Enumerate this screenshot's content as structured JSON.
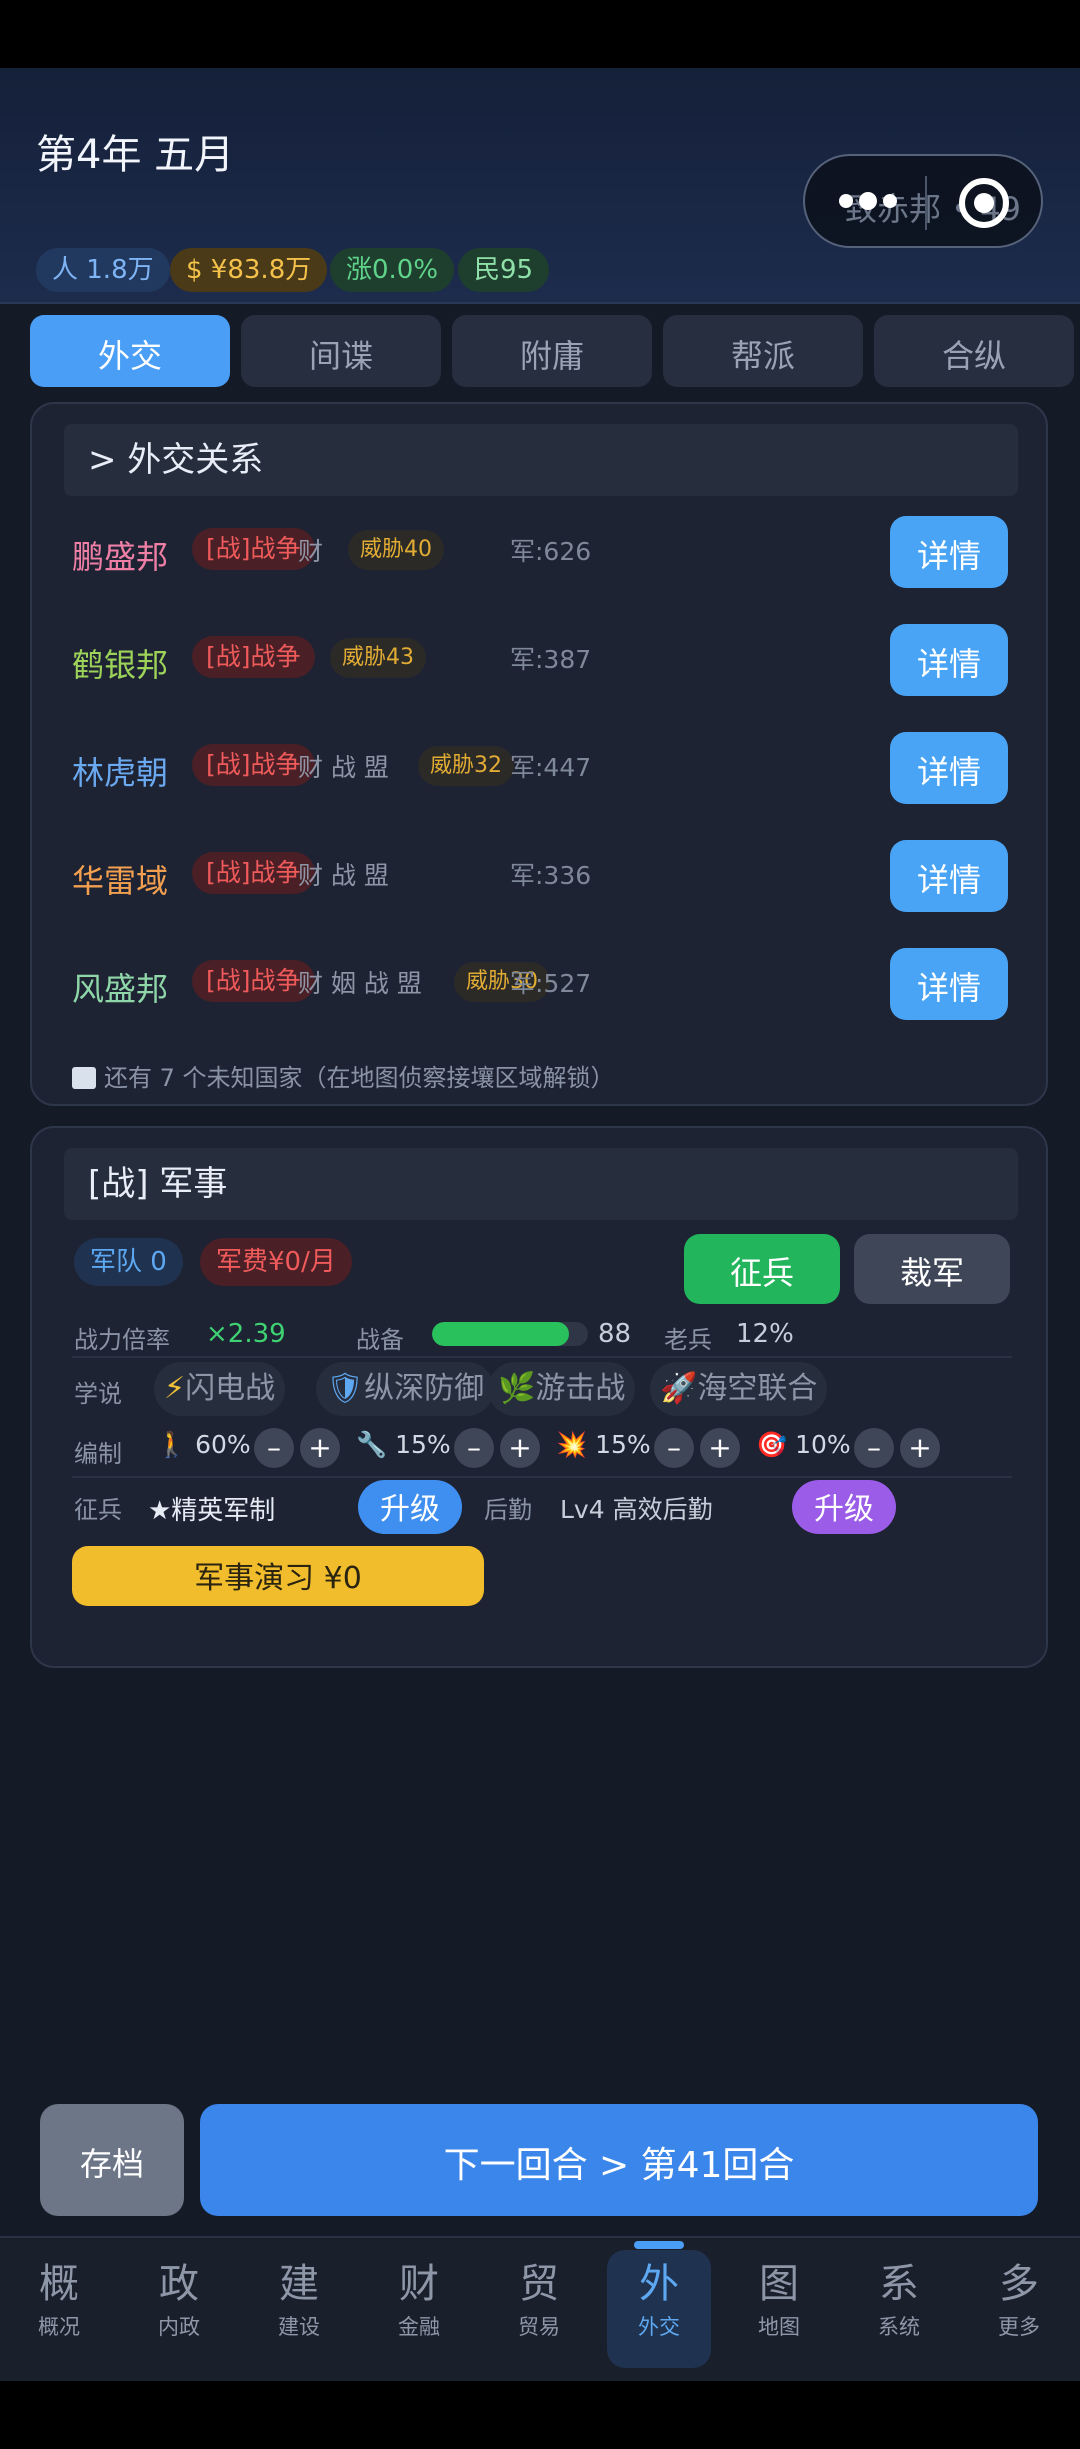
{
  "header": {
    "year_title": "第4年 五月",
    "capsule_ghost": "致赤邦 • 49",
    "stats": {
      "population": "人 1.8万",
      "money": "$ ¥83.8万",
      "rise": "涨0.0%",
      "people": "民95"
    }
  },
  "tabs": [
    "外交",
    "间谍",
    "附庸",
    "帮派",
    "合纵"
  ],
  "diplomacy": {
    "title": ">  外交关系",
    "detail_label": "详情",
    "rows": [
      {
        "name": "鹏盛邦",
        "color": "#f07fa6",
        "war": "[战]战争",
        "tags": "财",
        "threat": "威胁40",
        "army": "军:626"
      },
      {
        "name": "鹤银邦",
        "color": "#9ed35a",
        "war": "[战]战争",
        "tags": "",
        "threat": "威胁43",
        "army": "军:387"
      },
      {
        "name": "林虎朝",
        "color": "#6aa8ef",
        "war": "[战]战争",
        "tags": "财 战 盟",
        "threat": "威胁32",
        "army": "军:447"
      },
      {
        "name": "华雷域",
        "color": "#f2a050",
        "war": "[战]战争",
        "tags": "财 战 盟",
        "threat": "",
        "army": "军:336"
      },
      {
        "name": "风盛邦",
        "color": "#8fd6a8",
        "war": "[战]战争",
        "tags": "财 姻 战 盟",
        "threat": "威胁30",
        "army": "军:527"
      }
    ],
    "unknown_note": "还有 7 个未知国家（在地图侦察接壤区域解锁）"
  },
  "military": {
    "title": "[战]  军事",
    "army_pill": "军队 0",
    "fee_pill": "军费¥0/月",
    "draft_button": "征兵",
    "cut_button": "裁军",
    "power_label": "战力倍率",
    "power_value": "×2.39",
    "readiness_label": "战备",
    "readiness_value": "88",
    "readiness_fraction": 0.88,
    "veteran_label": "老兵",
    "veteran_value": "12%",
    "doctrine_label": "学说",
    "doctrines": [
      {
        "icon": "⚡",
        "label": "闪电战"
      },
      {
        "icon": "🛡",
        "label": "纵深防御"
      },
      {
        "icon": "🌿",
        "label": "游击战"
      },
      {
        "icon": "🚀",
        "label": "海空联合"
      }
    ],
    "formation_label": "编制",
    "formation": [
      {
        "icon": "🚶",
        "pct": "60%"
      },
      {
        "icon": "🔧",
        "pct": "15%"
      },
      {
        "icon": "💥",
        "pct": "15%"
      },
      {
        "icon": "🎯",
        "pct": "10%"
      }
    ],
    "minus": "–",
    "plus": "+",
    "draft_label": "征兵",
    "draft_value": "★精英军制",
    "upgrade_label": "升级",
    "logistics_label": "后勤",
    "logistics_value": "Lv4 高效后勤",
    "drill_button": "军事演习 ¥0"
  },
  "actions": {
    "save": "存档",
    "next": "下一回合 > 第41回合"
  },
  "nav": [
    {
      "glyph": "概",
      "label": "概况"
    },
    {
      "glyph": "政",
      "label": "内政"
    },
    {
      "glyph": "建",
      "label": "建设"
    },
    {
      "glyph": "财",
      "label": "金融"
    },
    {
      "glyph": "贸",
      "label": "贸易"
    },
    {
      "glyph": "外",
      "label": "外交"
    },
    {
      "glyph": "图",
      "label": "地图"
    },
    {
      "glyph": "系",
      "label": "系统"
    },
    {
      "glyph": "多",
      "label": "更多"
    }
  ]
}
